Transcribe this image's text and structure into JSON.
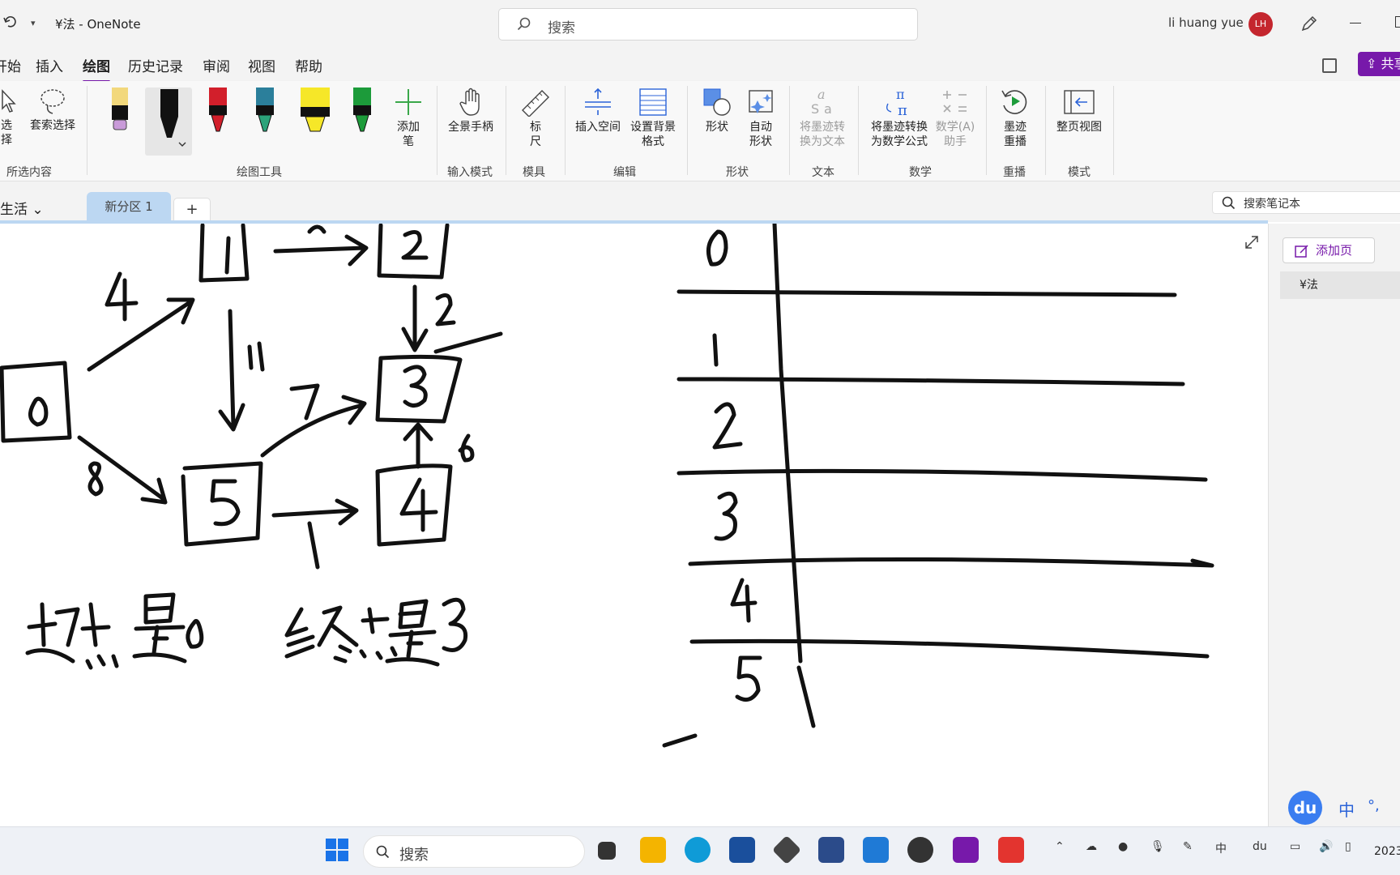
{
  "window": {
    "title": "¥法 - OneNote",
    "search_placeholder": "搜索",
    "user_name": "li huang yue",
    "user_initials": "LH"
  },
  "menu": {
    "tabs": [
      "开始",
      "插入",
      "绘图",
      "历史记录",
      "审阅",
      "视图",
      "帮助"
    ],
    "active_tab": "绘图",
    "share_label": "共享"
  },
  "ribbon": {
    "select_label": "选择",
    "lasso_label": "套索选择",
    "add_pen_label": "添加笔",
    "pan_label": "全景手柄",
    "ruler_label": "标尺",
    "insert_space_label": "插入空间",
    "bg_format_label": "设置背景格式",
    "shapes_label": "形状",
    "auto_shapes_label": "自动形状",
    "ink_to_text_label": "将墨迹转换为文本",
    "ink_to_math_label": "将墨迹转换为数学公式",
    "math_assistant_label": "数学(A)助手",
    "ink_replay_label": "墨迹重播",
    "full_page_label": "整页视图",
    "groups": {
      "selection": "所选内容",
      "drawing_tools": "绘图工具",
      "input_mode": "输入模式",
      "stencils": "模具",
      "edit": "编辑",
      "shapes": "形状",
      "text": "文本",
      "math": "数学",
      "replay": "重播",
      "mode": "模式"
    },
    "pen_colors": [
      "#f2d87c",
      "#111111",
      "#d21f2b",
      "#1f6f57",
      "#f6e728",
      "#1c9b3a"
    ]
  },
  "notebook": {
    "name": "生活",
    "section_tab": "新分区 1",
    "add_section": "+",
    "search_placeholder": "搜索笔记本"
  },
  "page_pane": {
    "add_page_label": "添加页",
    "pages": [
      "¥法"
    ]
  },
  "ime": {
    "logo": "du",
    "lang": "中",
    "punct": "°,"
  },
  "taskbar": {
    "search_placeholder": "搜索",
    "clock": "2023"
  }
}
